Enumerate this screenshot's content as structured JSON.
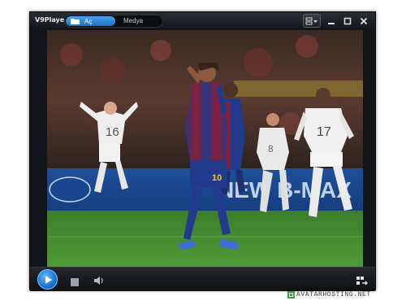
{
  "app": {
    "title": "V9Player"
  },
  "tabs": {
    "open_label": "Aç",
    "media_label": "Medya"
  },
  "icons": {
    "folder": "folder-icon",
    "menu": "menu-icon",
    "minimize": "minimize-icon",
    "maximize": "maximize-icon",
    "close": "close-icon",
    "play": "play-icon",
    "stop": "stop-icon",
    "volume": "volume-icon",
    "playlist": "playlist-icon"
  },
  "colors": {
    "accent": "#1f6fc4",
    "frame": "#111418",
    "pitch": "#3f8a2e"
  },
  "video": {
    "banner_text": "NEW B-MAX",
    "player_front_number": "10",
    "player_left_number": "16",
    "player_right_number": "17",
    "player_center_number": "8"
  },
  "watermark": {
    "text": "AVATARHOSTING.NET"
  }
}
